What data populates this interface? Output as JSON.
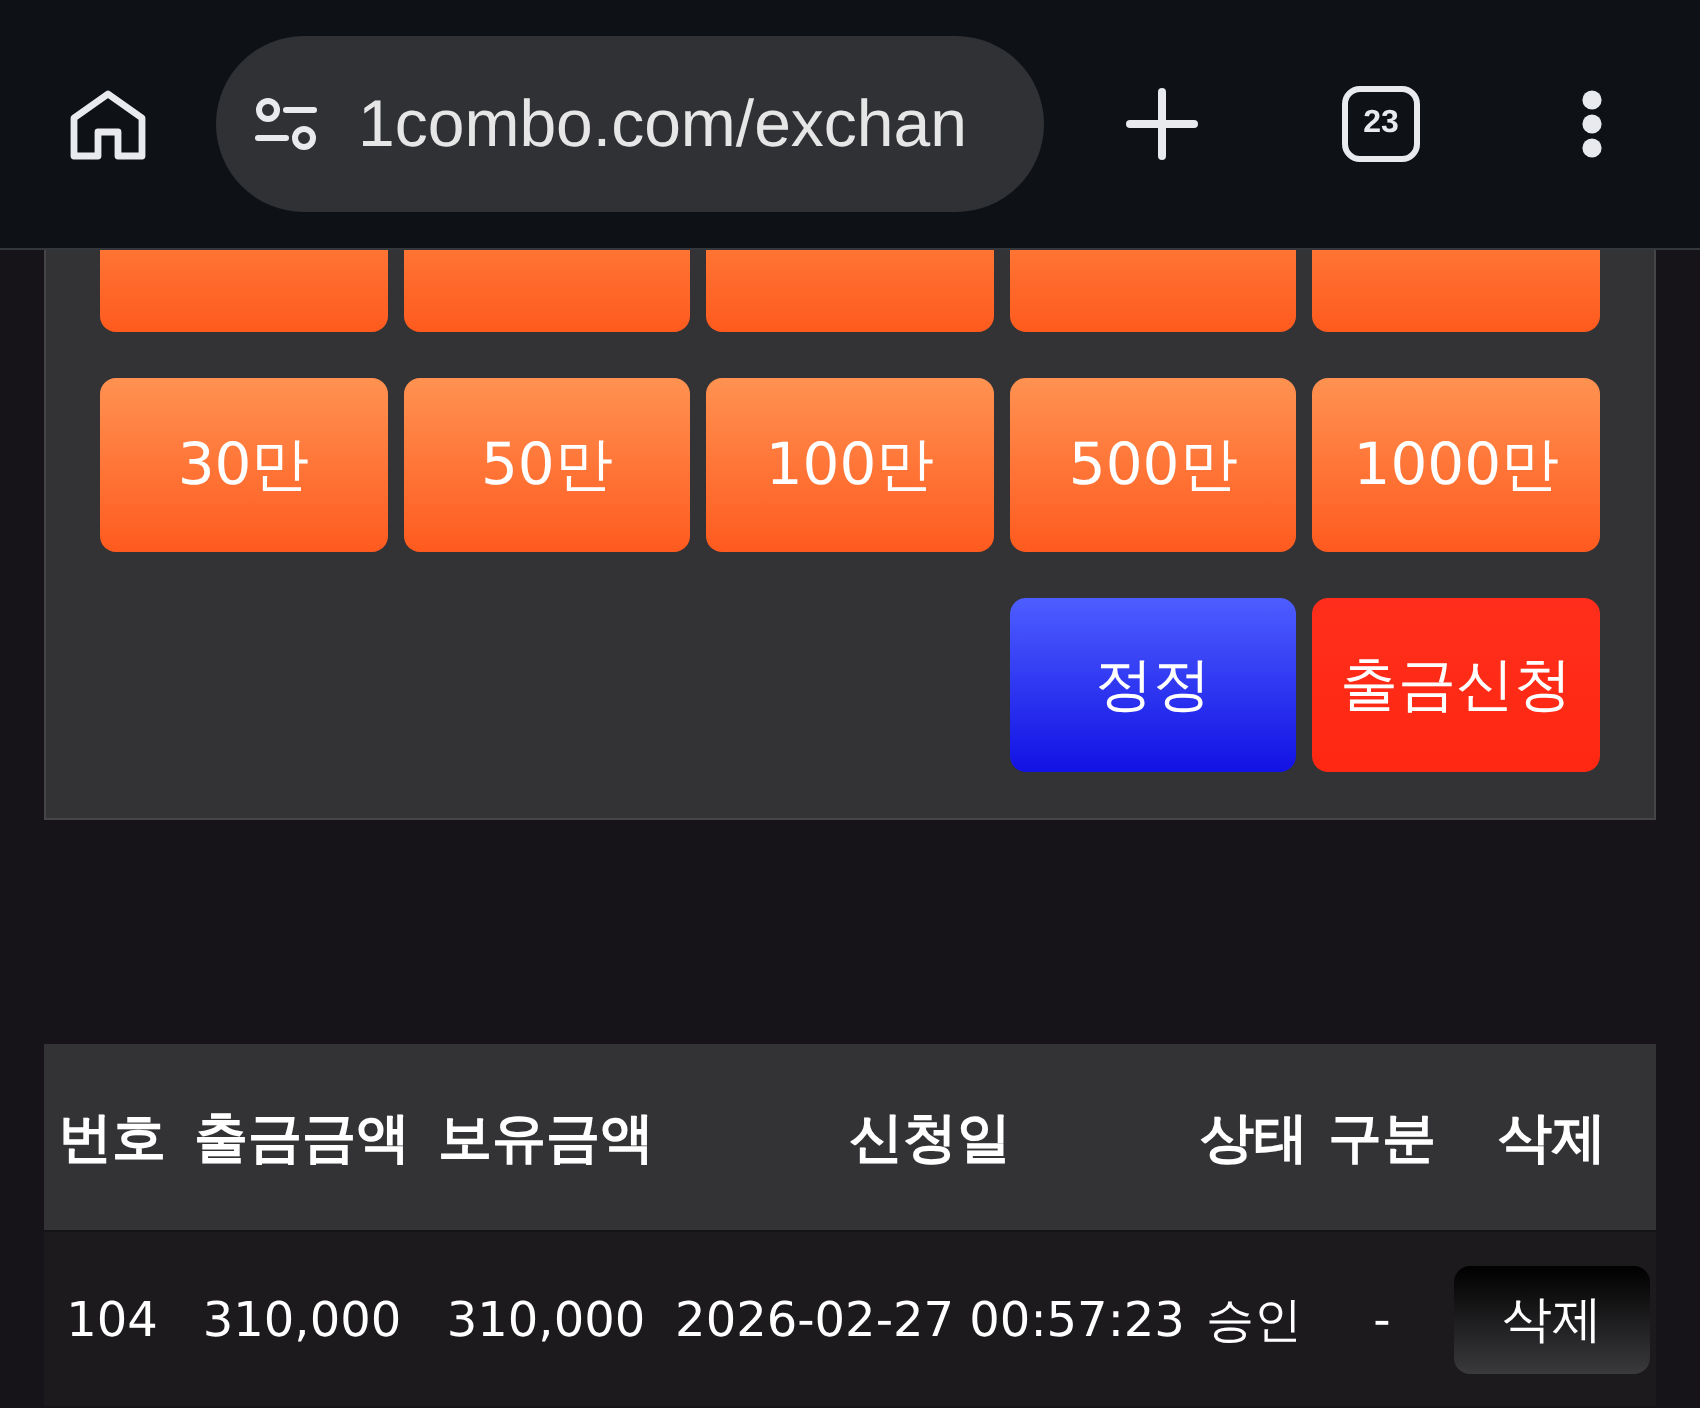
{
  "browser": {
    "url": "1combo.com/exchan",
    "tab_count": "23"
  },
  "amount_buttons": [
    {
      "kind": "cut"
    },
    {
      "kind": "cut"
    },
    {
      "kind": "cut"
    },
    {
      "kind": "cut"
    },
    {
      "kind": "cut"
    },
    {
      "kind": "full",
      "label": "30만"
    },
    {
      "kind": "full",
      "label": "50만"
    },
    {
      "kind": "full",
      "label": "100만"
    },
    {
      "kind": "full",
      "label": "500만"
    },
    {
      "kind": "full",
      "label": "1000만"
    }
  ],
  "actions": [
    {
      "kind": "correct",
      "label": "정정"
    },
    {
      "kind": "submit",
      "label": "출금신청"
    }
  ],
  "table": {
    "columns": [
      "번호",
      "출금금액",
      "보유금액",
      "신청일",
      "상태",
      "구분",
      "삭제"
    ],
    "rows": [
      {
        "cells": [
          "104",
          "310,000",
          "310,000",
          "2026-02-27 00:57:23",
          "승인",
          "-"
        ],
        "action": "삭제"
      }
    ]
  }
}
